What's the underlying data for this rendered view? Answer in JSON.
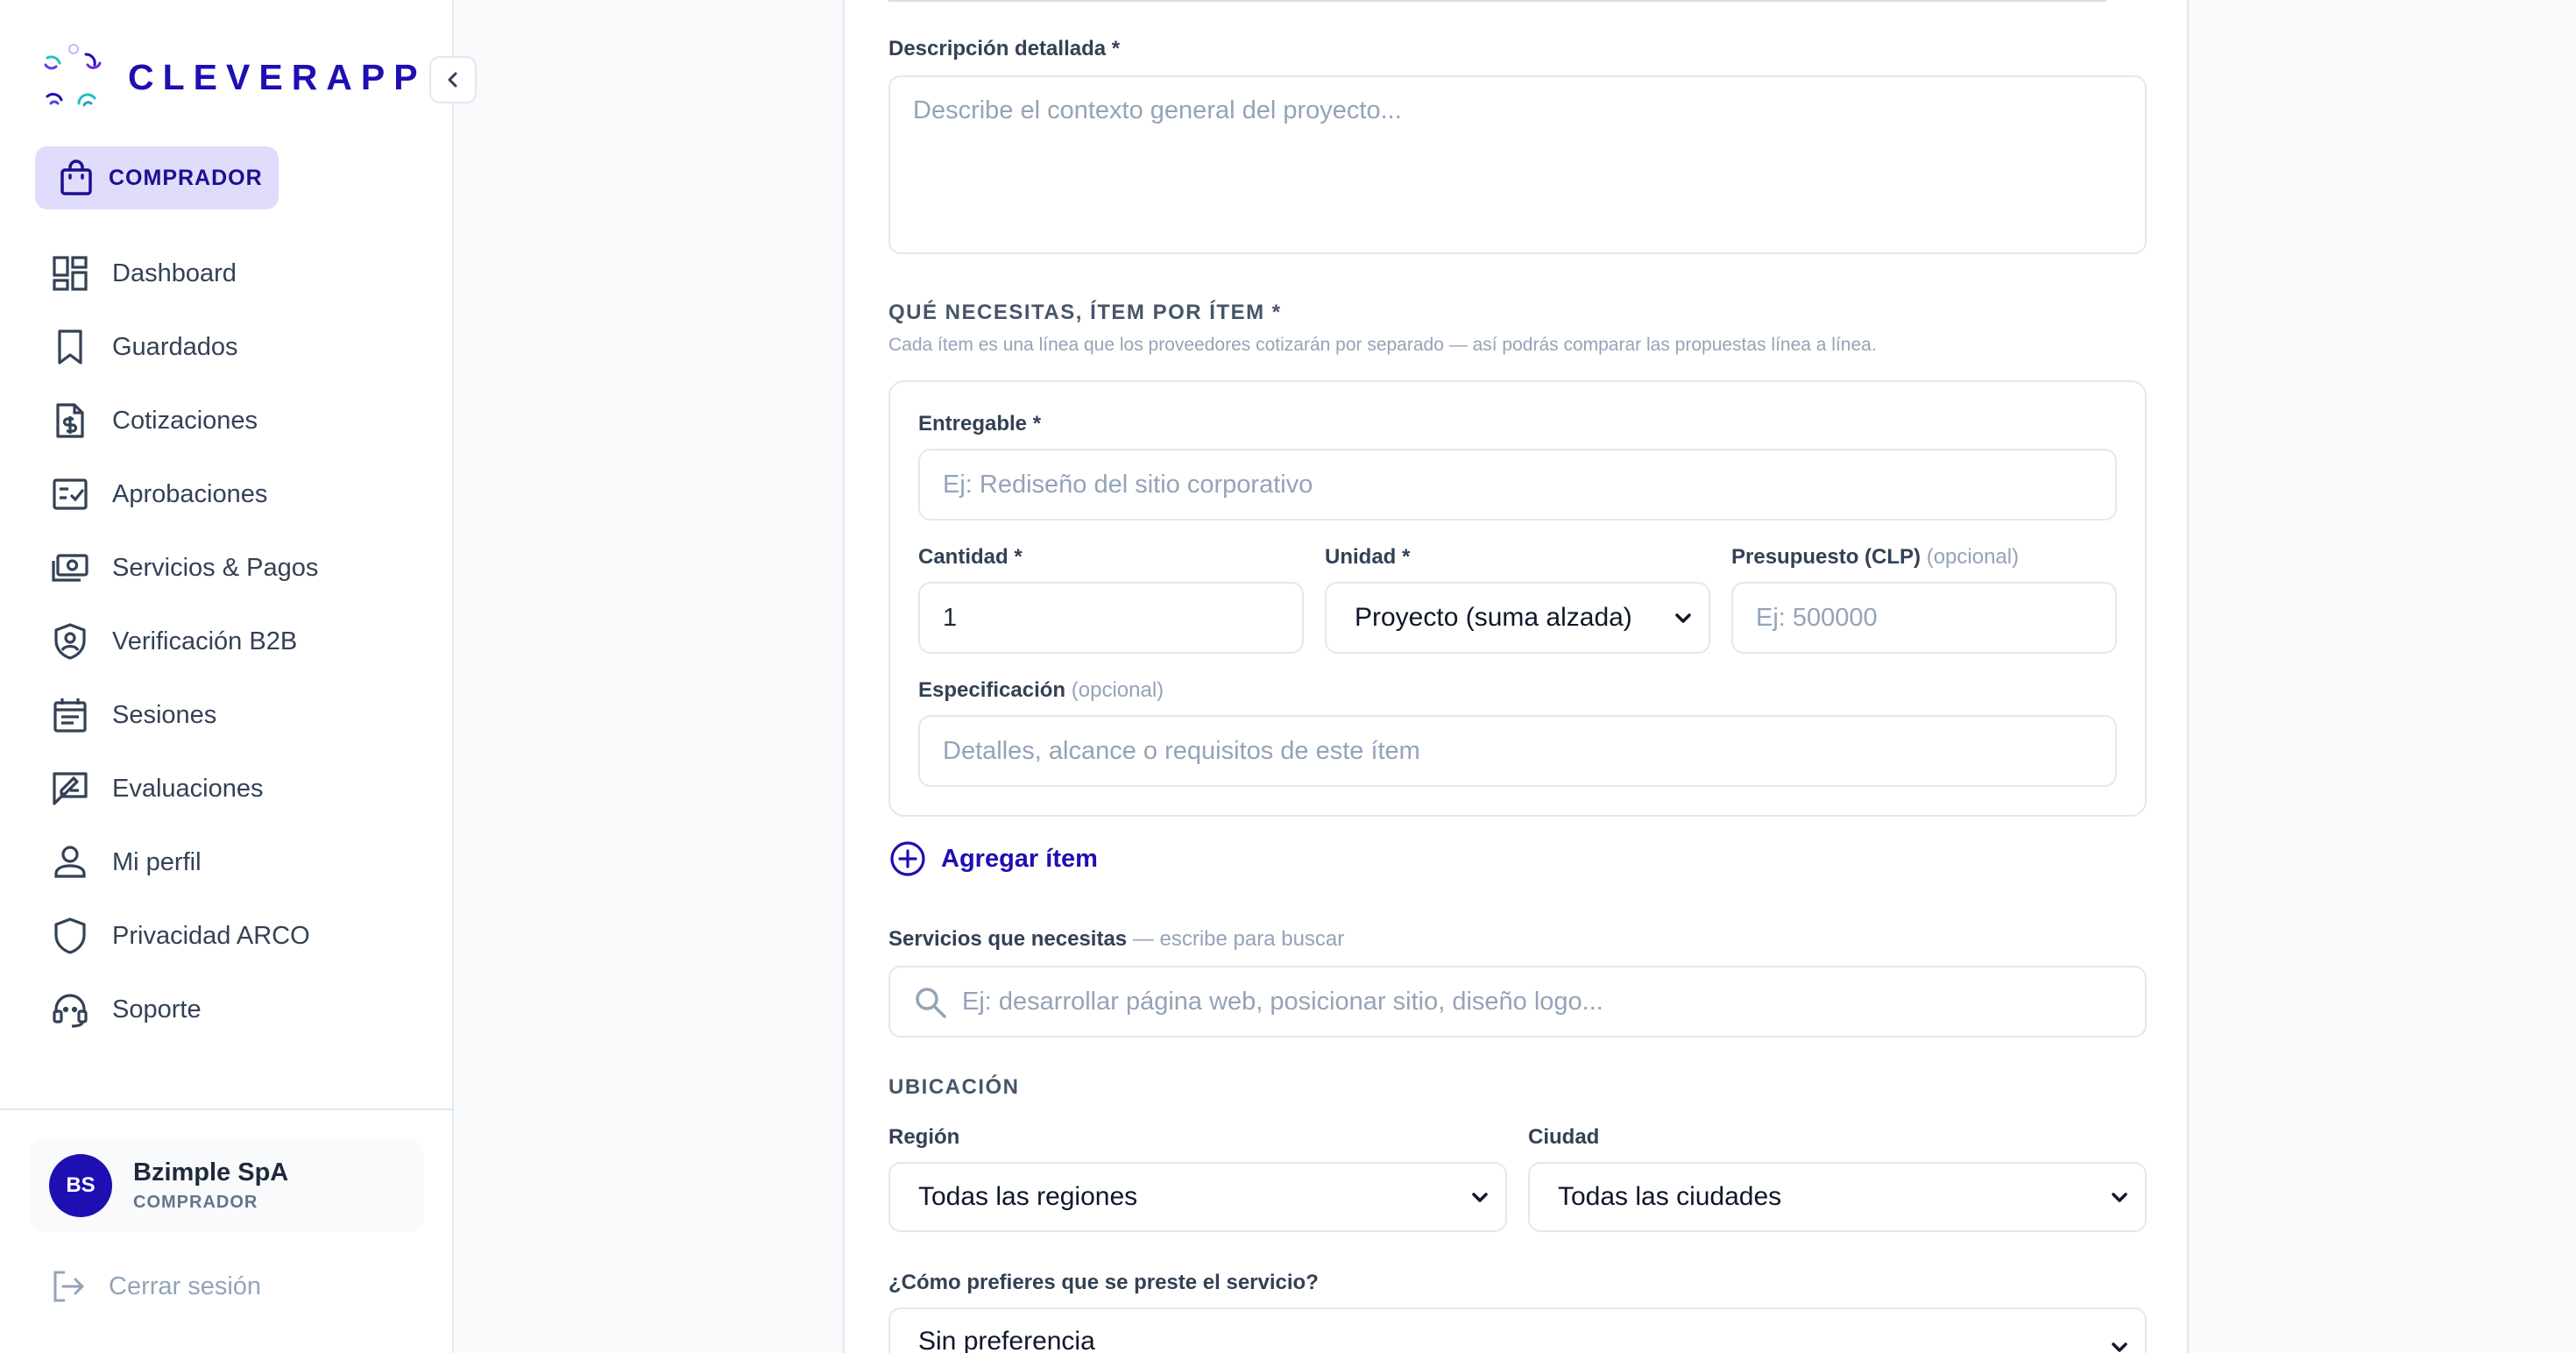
{
  "brand": {
    "name": "CLEVERAPP"
  },
  "sidebar": {
    "role_badge": "COMPRADOR",
    "items": [
      {
        "label": "Dashboard",
        "icon": "dashboard-icon"
      },
      {
        "label": "Guardados",
        "icon": "bookmark-icon"
      },
      {
        "label": "Cotizaciones",
        "icon": "quote-document-icon"
      },
      {
        "label": "Aprobaciones",
        "icon": "checklist-icon"
      },
      {
        "label": "Servicios & Pagos",
        "icon": "payments-icon"
      },
      {
        "label": "Verificación B2B",
        "icon": "shield-user-icon"
      },
      {
        "label": "Sesiones",
        "icon": "calendar-icon"
      },
      {
        "label": "Evaluaciones",
        "icon": "review-icon"
      },
      {
        "label": "Mi perfil",
        "icon": "user-icon"
      },
      {
        "label": "Privacidad ARCO",
        "icon": "shield-icon"
      },
      {
        "label": "Soporte",
        "icon": "headset-icon"
      }
    ],
    "user": {
      "initials": "BS",
      "name": "Bzimple SpA",
      "role": "COMPRADOR"
    },
    "logout_label": "Cerrar sesión"
  },
  "form": {
    "description": {
      "label": "Descripción detallada *",
      "placeholder": "Describe el contexto general del proyecto..."
    },
    "items_section": {
      "title": "QUÉ NECESITAS, ÍTEM POR ÍTEM *",
      "subtitle": "Cada ítem es una línea que los proveedores cotizarán por separado — así podrás comparar las propuestas línea a línea.",
      "deliverable_label": "Entregable *",
      "deliverable_placeholder": "Ej: Rediseño del sitio corporativo",
      "quantity_label": "Cantidad *",
      "quantity_value": "1",
      "unit_label": "Unidad *",
      "unit_value": "Proyecto (suma alzada)",
      "budget_label": "Presupuesto (CLP)",
      "budget_optional": "(opcional)",
      "budget_placeholder": "Ej: 500000",
      "spec_label": "Especificación",
      "spec_optional": "(opcional)",
      "spec_placeholder": "Detalles, alcance o requisitos de este ítem",
      "add_item_label": "Agregar ítem"
    },
    "services": {
      "label": "Servicios que necesitas",
      "hint": "— escribe para buscar",
      "placeholder": "Ej: desarrollar página web, posicionar sitio, diseño logo..."
    },
    "location": {
      "title": "UBICACIÓN",
      "region_label": "Región",
      "region_value": "Todas las regiones",
      "city_label": "Ciudad",
      "city_value": "Todas las ciudades"
    },
    "delivery": {
      "label": "¿Cómo prefieres que se preste el servicio?",
      "value": "Sin preferencia"
    }
  },
  "colors": {
    "brand": "#1e0fb3",
    "badge_bg": "#e0dcfb",
    "border": "#e2e8f0"
  }
}
